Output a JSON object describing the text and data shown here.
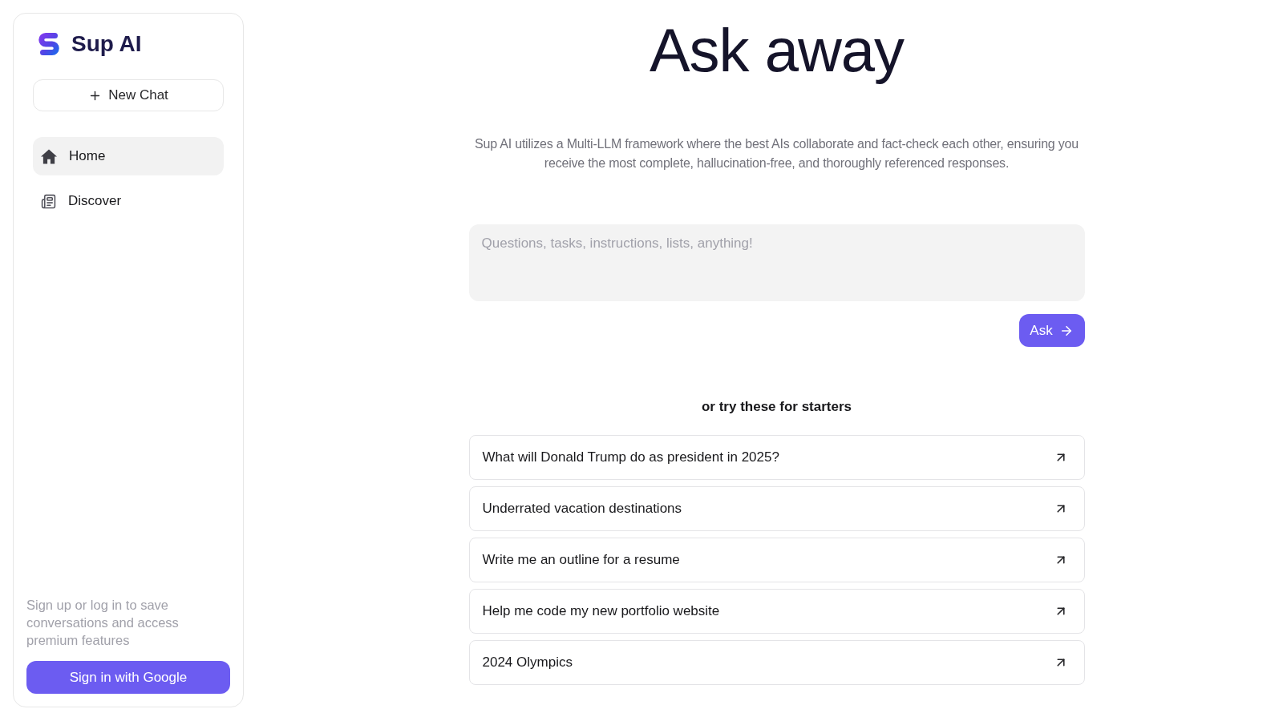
{
  "sidebar": {
    "brand": "Sup AI",
    "new_chat": "New Chat",
    "nav": [
      {
        "label": "Home",
        "selected": true
      },
      {
        "label": "Discover",
        "selected": false
      }
    ],
    "signup_prompt": "Sign up or log in to save conversations and access premium features",
    "sign_in_button": "Sign in with Google"
  },
  "main": {
    "title": "Ask away",
    "description": "Sup AI utilizes a Multi-LLM framework where the best AIs collaborate and fact-check each other, ensuring you receive the most complete, hallucination-free, and thoroughly referenced responses.",
    "input": {
      "placeholder": "Questions, tasks, instructions, lists, anything!"
    },
    "submit_button": "Ask",
    "starters_heading": "or try these for starters",
    "starters": [
      "What will Donald Trump do as president in 2025?",
      "Underrated vacation destinations",
      "Write me an outline for a resume",
      "Help me code my new portfolio website",
      "2024 Olympics"
    ]
  }
}
